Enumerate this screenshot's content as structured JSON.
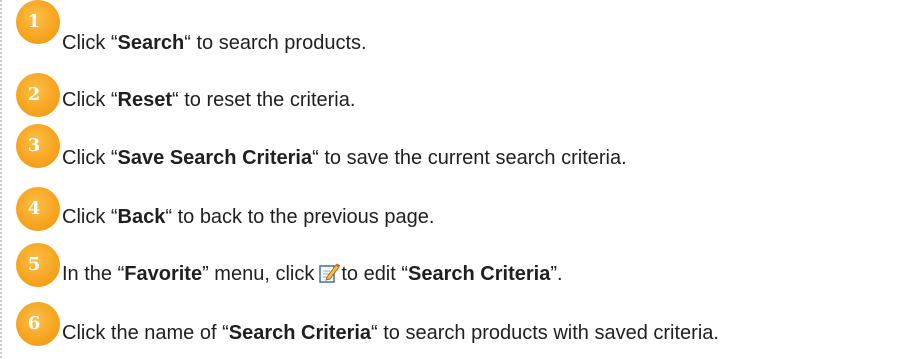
{
  "steps": [
    {
      "number": "1",
      "prefix": "Click “",
      "bold": "Search",
      "suffix": "“ to search products."
    },
    {
      "number": "2",
      "prefix": "Click “",
      "bold": "Reset",
      "suffix": "“ to reset the criteria."
    },
    {
      "number": "3",
      "prefix": "Click “",
      "bold": "Save Search Criteria",
      "suffix": "“ to save the current search criteria."
    },
    {
      "number": "4",
      "prefix": "Click “",
      "bold": "Back",
      "suffix": "“ to back to the previous page."
    },
    {
      "number": "5",
      "prefix": "In the “",
      "bold": "Favorite",
      "middle": "” menu, click",
      "middle2": "to edit “",
      "bold2": "Search Criteria",
      "suffix": "”."
    },
    {
      "number": "6",
      "prefix": "Click the name of “",
      "bold": "Search Criteria",
      "suffix": "“ to search products with saved criteria."
    }
  ],
  "icons": {
    "edit": "edit-icon"
  },
  "colors": {
    "badge": "#f7a520",
    "text": "#1f1f1f"
  }
}
